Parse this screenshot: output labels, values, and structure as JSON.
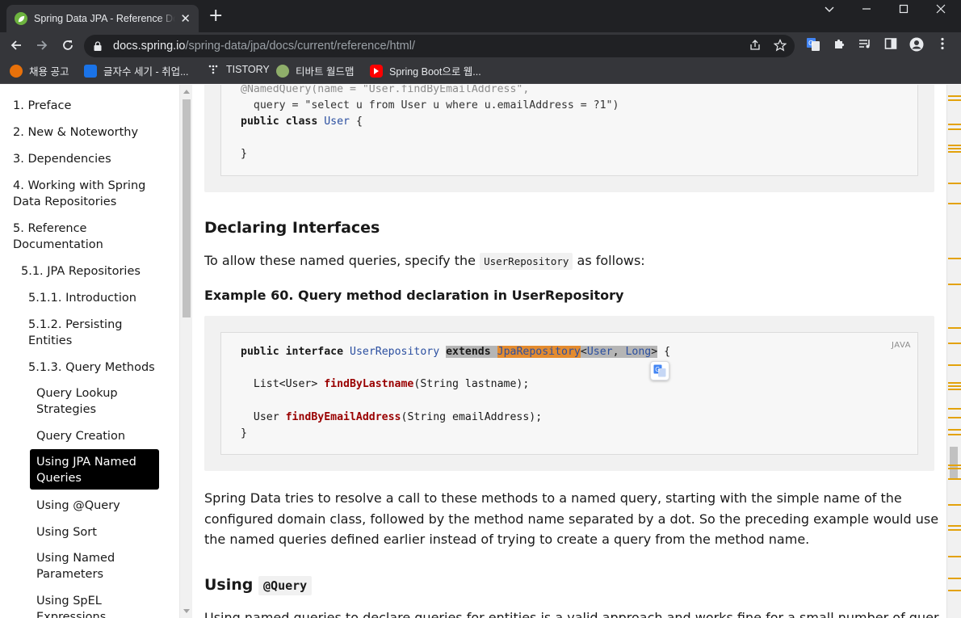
{
  "browser": {
    "tab_title": "Spring Data JPA - Reference Documentation",
    "tab_close": "✕",
    "new_tab": "+",
    "url_host": "docs.spring.io",
    "url_path": "/spring-data/jpa/docs/current/reference/html/",
    "bookmarks": [
      {
        "label": "채용 공고",
        "icon": "orange-circle-icon",
        "color": "#e8710a"
      },
      {
        "label": "글자수 세기 - 취업...",
        "icon": "blue-chat-icon",
        "color": "#1a73e8"
      },
      {
        "label": "TISTORY",
        "icon": "tistory-dots-icon",
        "color": "#e8eaed"
      },
      {
        "label": "티바트 월드맵",
        "icon": "globe-icon",
        "color": "#8fae6a"
      },
      {
        "label": "Spring Boot으로 웹...",
        "icon": "youtube-icon",
        "color": "#ff0000"
      }
    ]
  },
  "sidebar": {
    "items": [
      {
        "label": "1. Preface"
      },
      {
        "label": "2. New & Noteworthy"
      },
      {
        "label": "3. Dependencies"
      },
      {
        "label": "4. Working with Spring",
        "label2": "Data Repositories"
      },
      {
        "label": "5. Reference",
        "label2": "Documentation"
      },
      {
        "label": "5.1. JPA Repositories"
      },
      {
        "label": "5.1.1. Introduction"
      },
      {
        "label": "5.1.2. Persisting",
        "label2": "Entities"
      },
      {
        "label": "5.1.3. Query Methods"
      },
      {
        "label": "Query Lookup",
        "label2": "Strategies"
      },
      {
        "label": "Query Creation"
      },
      {
        "label": "Using JPA Named",
        "label2": "Queries"
      },
      {
        "label": "Using @Query"
      },
      {
        "label": "Using Sort"
      },
      {
        "label": "Using Named",
        "label2": "Parameters"
      },
      {
        "label": "Using SpEL",
        "label2": "Expressions"
      }
    ]
  },
  "content": {
    "code1": {
      "line1": "@NamedQuery(name = \"User.findByEmailAddress\",",
      "line2": "  query = \"select u from User u where u.emailAddress = ?1\")",
      "line3_kw": "public class",
      "line3_type": "User",
      "line3_end": " {",
      "line4": "}"
    },
    "heading_declaring": "Declaring Interfaces",
    "para1_before": "To allow these named queries, specify the",
    "para1_code": "UserRepository",
    "para1_after": "as follows:",
    "example_title": "Example 60. Query method declaration in UserRepository",
    "code2": {
      "lang": "JAVA",
      "l1_kw": "public interface",
      "l1_type": "UserRepository",
      "l1_extends": "extends",
      "l1_jpa": "JpaRepository",
      "l1_lt": "<",
      "l1_user": "User",
      "l1_comma": ", ",
      "l1_long": "Long",
      "l1_gt": ">",
      "l1_end": " {",
      "l2_type": "  List<User> ",
      "l2_fn": "findByLastname",
      "l2_rest": "(String lastname);",
      "l3_type": "  User ",
      "l3_fn": "findByEmailAddress",
      "l3_rest": "(String emailAddress);",
      "l4": "}"
    },
    "para2": "Spring Data tries to resolve a call to these methods to a named query, starting with the simple name of the configured domain class, followed by the method name separated by a dot. So the preceding example would use the named queries defined earlier instead of trying to create a query from the method name.",
    "heading_using": "Using",
    "heading_using_code": "@Query",
    "para3": "Using named queries to declare queries for entities is a valid approach and works fine for a small number of queries. As"
  }
}
